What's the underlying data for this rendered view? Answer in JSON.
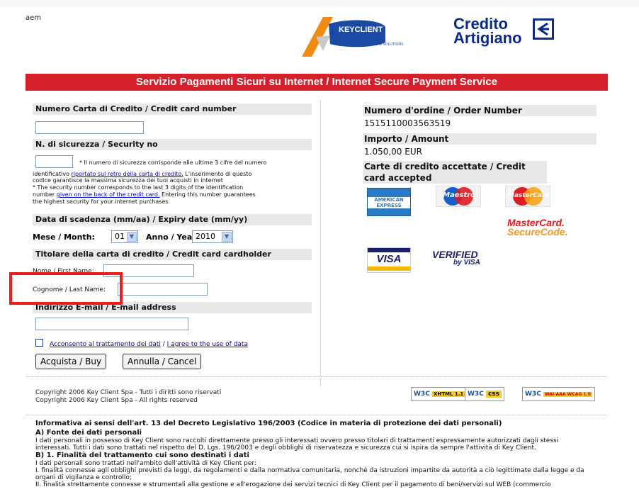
{
  "header": {
    "corner_text": "aem",
    "keyclient_logo": {
      "name": "KEYCLIENT",
      "tagline": "CARDS & SOLUTIONS"
    },
    "bank_logo": {
      "line1": "Credito",
      "line2": "Artigiano"
    },
    "banner": "Servizio Pagamenti Sicuri su Internet / Internet Secure Payment Service"
  },
  "form": {
    "card_number_heading": "Numero Carta di Credito / Credit card number",
    "card_number_value": "",
    "security_heading": "N. di sicurezza / Security no",
    "security_value": "",
    "security_note_it_1": "* Il numero di sicurezza corrisponde alle ultime 3 cifre del numero",
    "security_note_it_2a": "identificativo ",
    "security_note_it_2_link": "riportato sul retro della carta di credito.",
    "security_note_it_2b": " L'inserimento di questo",
    "security_note_it_3": "codice garantisce la massima sicurezza dei tuoi acquisti in internet",
    "security_note_en_1": "* The security number corresponds to the last 3 digits of the identification",
    "security_note_en_2a": "number ",
    "security_note_en_2_link": "given on the back of the credit card.",
    "security_note_en_2b": " Entering this number guarantees",
    "security_note_en_3": "the highest security for your internet purchases",
    "expiry_heading": "Data di scadenza (mm/aa) / Expiry date (mm/yy)",
    "month_label_it": "Mese",
    "month_label_en": " / Month:",
    "month_value": "01",
    "year_label_it": "Anno",
    "year_label_en": " / Year:",
    "year_value": "2010",
    "holder_heading": "Titolare della carta di credito / Credit card cardholder",
    "first_name_label": "Nome / First Name:",
    "first_name_value": "",
    "last_name_label": "Cognome / Last Name:",
    "last_name_value": "",
    "email_heading": "Indirizzo E-mail / E-mail address",
    "email_value": "",
    "consent_link_it": "Acconsento al trattamento dei dati",
    "consent_sep": " / ",
    "consent_link_en": "I agree to the use of data",
    "buy_button": "Acquista / Buy",
    "cancel_button": "Annulla / Cancel"
  },
  "order": {
    "order_heading": "Numero d'ordine / Order Number",
    "order_number": "1515110003563519",
    "amount_heading": "Importo / Amount",
    "amount": "1.050,00 EUR",
    "cards_heading": "Carte di credito accettate / Credit card accepted",
    "cards": {
      "amex_1": "AMERICAN",
      "amex_2": "EXPRESS",
      "maestro": "Maestro",
      "mastercard": "MasterCard",
      "securecode_1": "MasterCard.",
      "securecode_2": "SecureCode.",
      "visa": "VISA",
      "verified_1": "VERIFIED",
      "verified_2": "by VISA"
    }
  },
  "footer": {
    "copyright_it": "Copyright 2006 Key Client Spa - Tutti i diritti sono riservati",
    "copyright_en": "Copyright 2006 Key Client Spa - All rights reserved",
    "badges": [
      {
        "w3c": "W3C",
        "label": "XHTML 1.1"
      },
      {
        "w3c": "W3C",
        "label": "css"
      },
      {
        "w3c": "W3C",
        "label": "WAI-AAA WCAG 1.0"
      }
    ]
  },
  "privacy": {
    "title": "Informativa ai sensi dell'art. 13 del Decreto Legislativo 196/2003 (Codice in materia di protezione dei dati personali)",
    "a_heading": "A) Fonte dei dati personali",
    "a_text": "I dati personali in possesso di Key Client sono raccolti direttamente presso gli interessati ovvero presso titolari di trattamenti espressamente autorizzati dagli stessi interessati. Tutti i dati sono trattati nel rispetto del D. Lgs. 196/2003 e degli obblighi di riservatezza e sicurezza cui si ispira da sempre l'attività di Key Client.",
    "b_heading": "B) 1. Finalità del trattamento cui sono destinati i dati",
    "b_intro": "I dati personali sono trattati nell'ambito dell'attività di Key Client per:",
    "b_item1": "I. finalità connesse agli obblighi previsti da leggi, da regolamenti e dalla normativa comunitaria, nonché da istruzioni impartite da autorità a ciò legittimate dalla legge e da organi di vigilanza e controllo;",
    "b_item2": "II. finalità strettamente connesse e strumentali alla gestione e all'erogazione dei servizi tecnici di Key Client per il pagamento di beni/servizi sul WEB (commercio"
  },
  "colors": {
    "banner_red": "#d51f2a",
    "highlight_red": "#ee1c1c",
    "bank_blue": "#0b2a8a"
  }
}
